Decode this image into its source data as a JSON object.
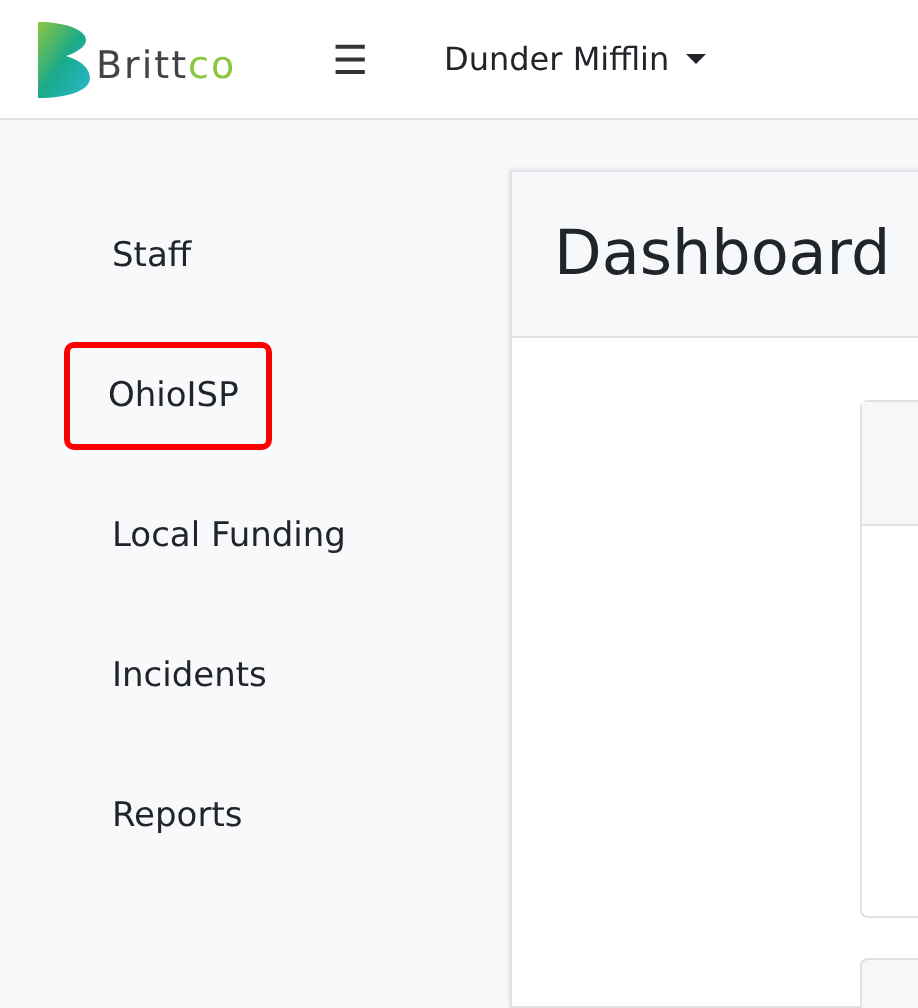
{
  "brand": {
    "name_start": "Britt",
    "name_end": "co"
  },
  "navbar": {
    "menu_icon": "☰",
    "organization": "Dunder Mifflin"
  },
  "sidebar": {
    "items": [
      {
        "label": "Staff",
        "highlighted": false
      },
      {
        "label": "OhioISP",
        "highlighted": true
      },
      {
        "label": "Local Funding",
        "highlighted": false
      },
      {
        "label": "Incidents",
        "highlighted": false
      },
      {
        "label": "Reports",
        "highlighted": false
      }
    ]
  },
  "main": {
    "title": "Dashboard"
  }
}
